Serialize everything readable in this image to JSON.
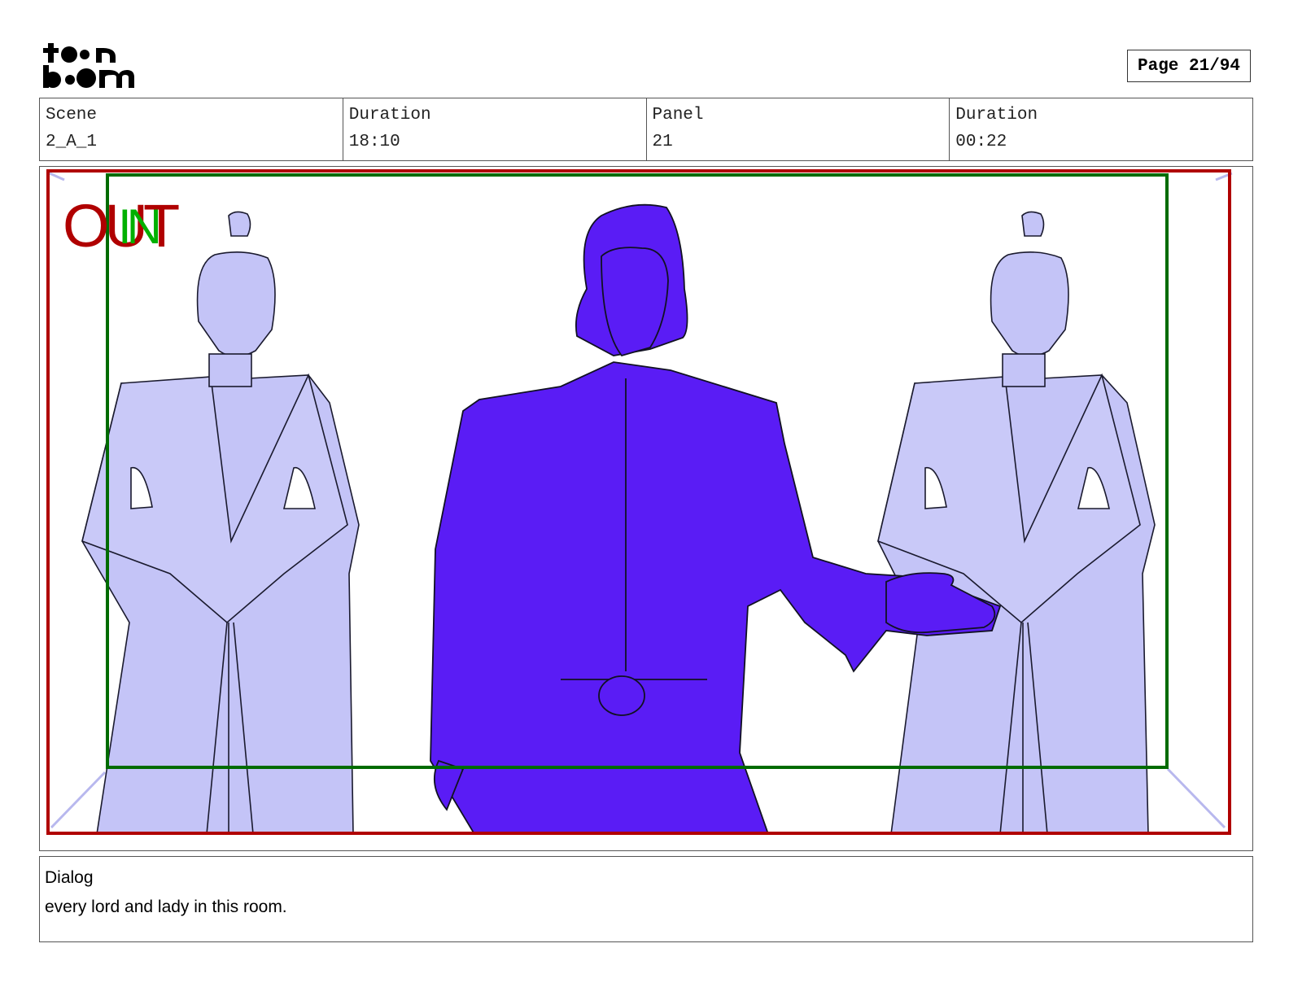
{
  "logo": {
    "text": "toon boom"
  },
  "page_indicator": "Page 21/94",
  "info": [
    {
      "label": "Scene",
      "value": "2_A_1"
    },
    {
      "label": "Duration",
      "value": "18:10"
    },
    {
      "label": "Panel",
      "value": "21"
    },
    {
      "label": "Duration",
      "value": "00:22"
    }
  ],
  "panel": {
    "out_label": "OUT",
    "in_label": "IN",
    "colors": {
      "out_frame": "#b00000",
      "in_frame": "#006b00",
      "main_figure": "#5a1cf5",
      "side_figures": "#c4c4f7"
    }
  },
  "dialog": {
    "label": "Dialog",
    "text": "every lord and lady in this room."
  }
}
